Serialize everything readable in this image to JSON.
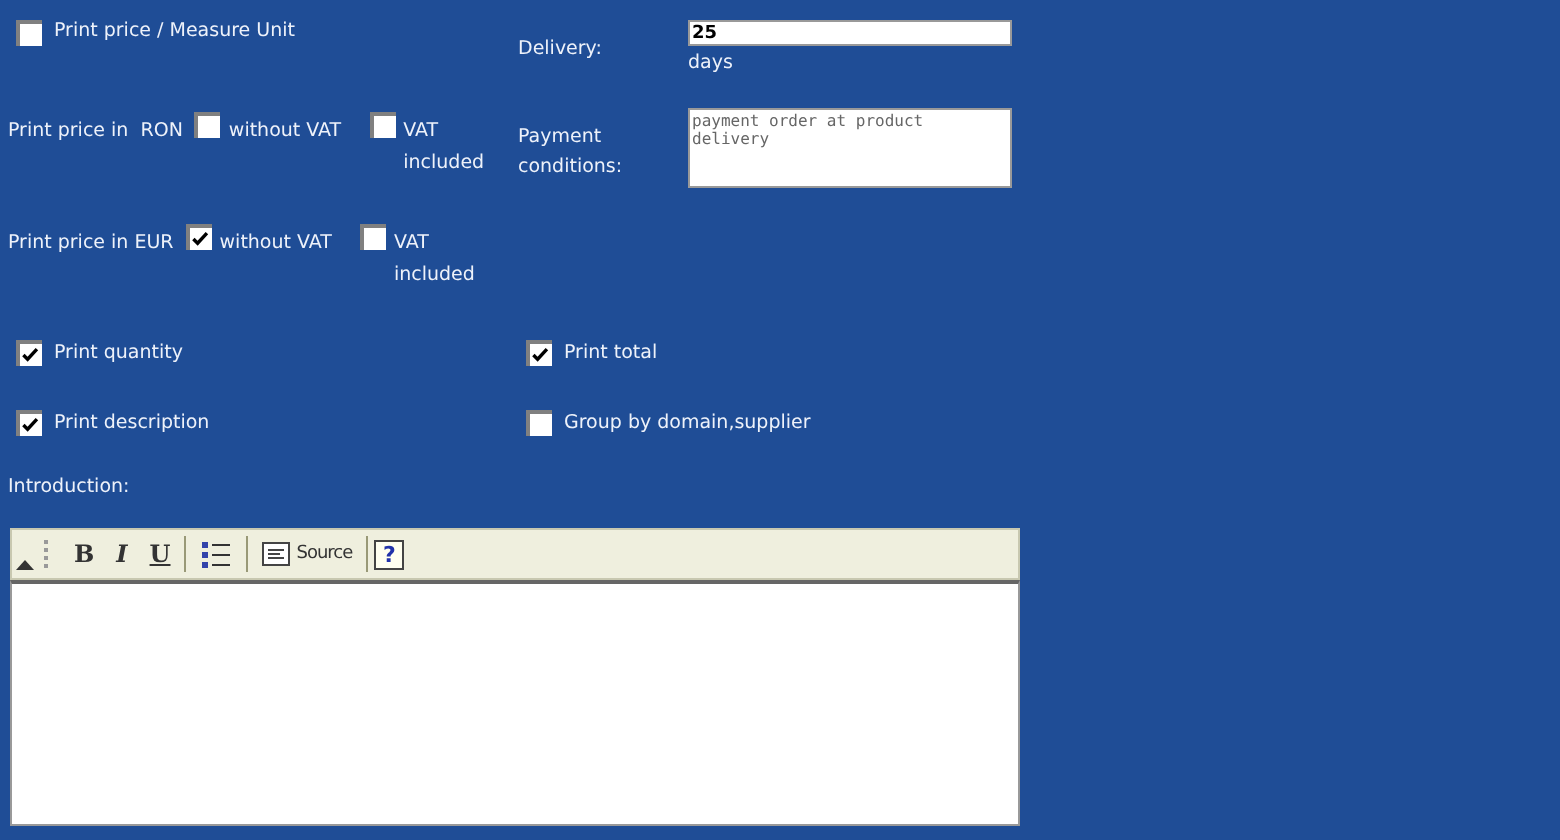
{
  "price_per_unit": {
    "label": "Print price / Measure Unit",
    "checked": false
  },
  "delivery": {
    "label": "Delivery:",
    "value": "25",
    "unit": "days"
  },
  "price_rows": [
    {
      "label": "Print price in  RON",
      "options": [
        {
          "label": "without VAT",
          "checked": false
        },
        {
          "label": "VAT included",
          "checked": false
        }
      ]
    },
    {
      "label": "Print price in EUR",
      "options": [
        {
          "label": "without VAT",
          "checked": true
        },
        {
          "label": "VAT included",
          "checked": false
        }
      ]
    }
  ],
  "payment": {
    "label": "Payment conditions:",
    "value": "payment order at product delivery"
  },
  "checks": [
    {
      "label": "Print quantity",
      "checked": true
    },
    {
      "label": "Print total",
      "checked": true
    },
    {
      "label": "Print description",
      "checked": true
    },
    {
      "label": "Group by domain,supplier",
      "checked": false
    }
  ],
  "introduction": {
    "label": "Introduction:",
    "toolbar": [
      {
        "kind": "collapse"
      },
      {
        "kind": "grip"
      },
      {
        "kind": "bold",
        "label": "B"
      },
      {
        "kind": "italic",
        "label": "I"
      },
      {
        "kind": "underline",
        "label": "U"
      },
      {
        "kind": "sep"
      },
      {
        "kind": "list"
      },
      {
        "kind": "sep"
      },
      {
        "kind": "source",
        "label": "Source"
      },
      {
        "kind": "sep"
      },
      {
        "kind": "help",
        "label": "?"
      }
    ]
  }
}
